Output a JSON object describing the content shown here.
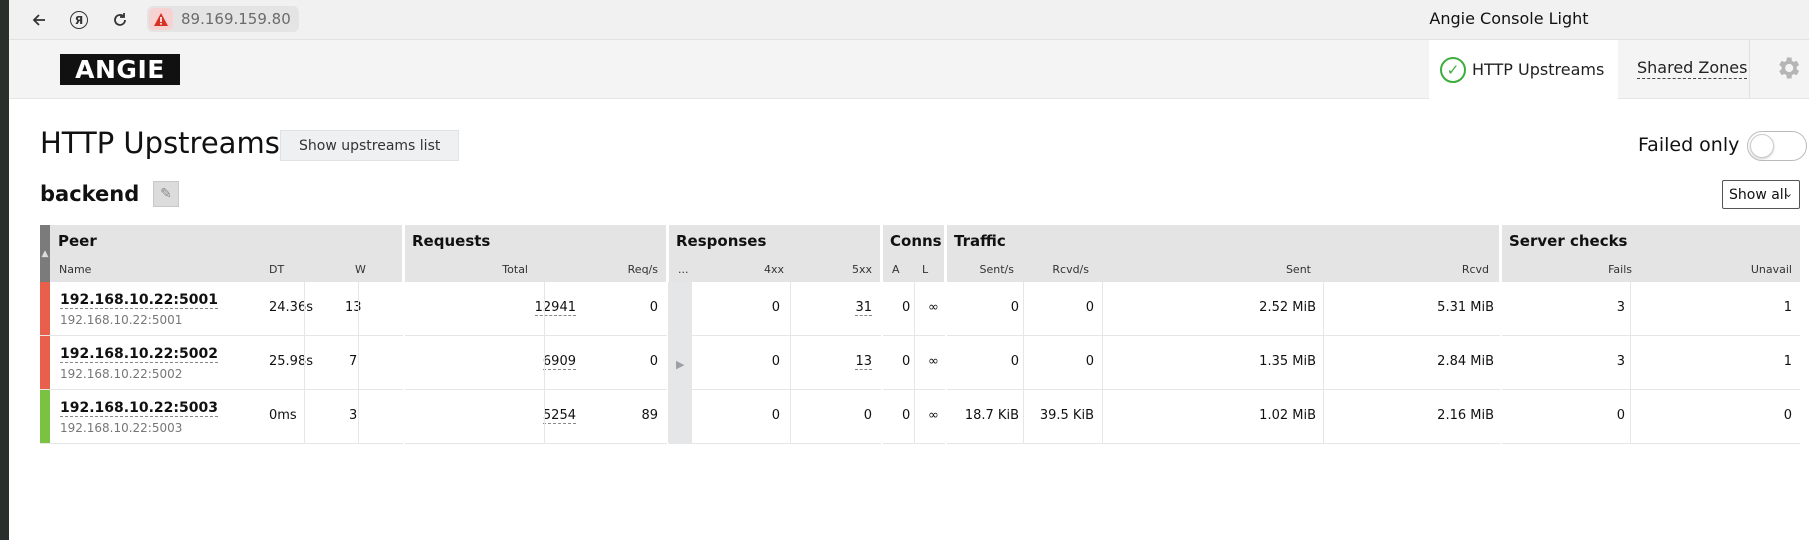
{
  "browser": {
    "url": "89.169.159.80",
    "tab_title": "Angie Console Light"
  },
  "header": {
    "logo": "ANGIE",
    "tabs": [
      {
        "label": "HTTP Upstreams",
        "active": true
      },
      {
        "label": "Shared Zones",
        "active": false
      }
    ]
  },
  "main": {
    "title": "HTTP Upstreams",
    "show_list_button": "Show upstreams list",
    "failed_only_label": "Failed only",
    "failed_only_on": false,
    "upstream_name": "backend",
    "filter_select": "Show all"
  },
  "table": {
    "groups": {
      "peer": "Peer",
      "requests": "Requests",
      "responses": "Responses",
      "conns": "Conns",
      "traffic": "Traffic",
      "server_checks": "Server checks"
    },
    "columns": {
      "name": "Name",
      "dt": "DT",
      "w": "W",
      "total": "Total",
      "req_s": "Req/s",
      "ellipsis": "...",
      "c4xx": "4xx",
      "c5xx": "5xx",
      "a": "A",
      "l": "L",
      "sent_s": "Sent/s",
      "rcvd_s": "Rcvd/s",
      "sent": "Sent",
      "rcvd": "Rcvd",
      "fails": "Fails",
      "unavail": "Unavail"
    },
    "rows": [
      {
        "name": "192.168.10.22:5001",
        "addr": "192.168.10.22:5001",
        "dt": "24.36s",
        "w": "13",
        "total": "12941",
        "req_s": "0",
        "c4xx": "0",
        "c5xx": "31",
        "a": "0",
        "l": "∞",
        "sent_s": "0",
        "rcvd_s": "0",
        "sent": "2.52 MiB",
        "rcvd": "5.31 MiB",
        "fails": "3",
        "unavail": "1",
        "status_color": "#e8604c"
      },
      {
        "name": "192.168.10.22:5002",
        "addr": "192.168.10.22:5002",
        "dt": "25.98s",
        "w": "7",
        "total": "6909",
        "req_s": "0",
        "c4xx": "0",
        "c5xx": "13",
        "a": "0",
        "l": "∞",
        "sent_s": "0",
        "rcvd_s": "0",
        "sent": "1.35 MiB",
        "rcvd": "2.84 MiB",
        "fails": "3",
        "unavail": "1",
        "status_color": "#e8604c"
      },
      {
        "name": "192.168.10.22:5003",
        "addr": "192.168.10.22:5003",
        "dt": "0ms",
        "w": "3",
        "total": "5254",
        "req_s": "89",
        "c4xx": "0",
        "c5xx": "0",
        "a": "0",
        "l": "∞",
        "sent_s": "18.7 KiB",
        "rcvd_s": "39.5 KiB",
        "sent": "1.02 MiB",
        "rcvd": "2.16 MiB",
        "fails": "0",
        "unavail": "0",
        "status_color": "#7cc242"
      }
    ]
  },
  "icons": {
    "back": "arrow-left-icon",
    "yandex": "yandex-icon",
    "reload": "reload-icon",
    "warning": "warning-icon",
    "check": "check-circle-icon",
    "gear": "gear-icon",
    "edit": "pencil-icon"
  }
}
